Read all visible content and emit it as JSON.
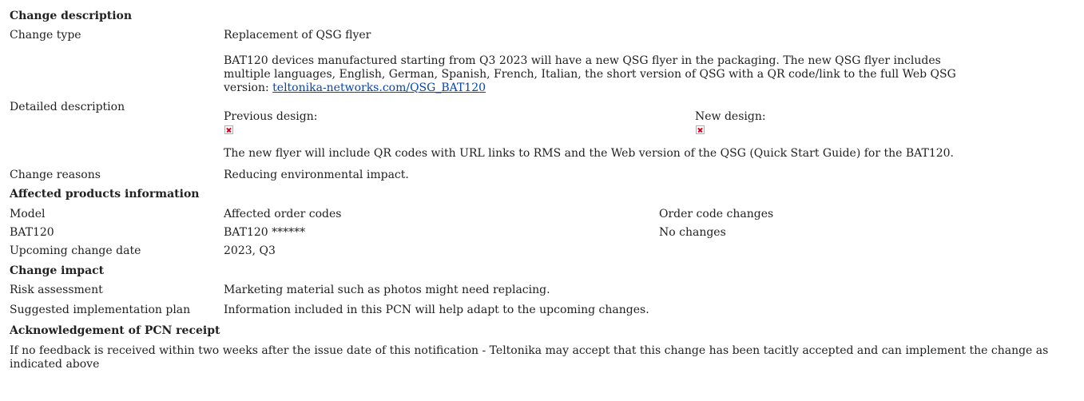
{
  "sections": {
    "change_description": "Change description",
    "affected_products": "Affected products information",
    "change_impact": "Change impact",
    "acknowledgement": "Acknowledgement of PCN receipt"
  },
  "change_type": {
    "label": "Change type",
    "value": "Replacement of QSG flyer"
  },
  "detailed": {
    "label": "Detailed description",
    "text_line1": "BAT120 devices manufactured starting from Q3 2023 will have a new QSG flyer in the packaging. The new QSG flyer includes",
    "text_line2": "multiple languages, English, German, Spanish, French, Italian, the short version of QSG with a QR code/link to the full Web QSG",
    "text_line3_prefix": "version: ",
    "link": "teltonika-networks.com/QSG_BAT120",
    "previous_design": "Previous design:",
    "new_design": "New design:",
    "note": "The new flyer will include QR codes with URL links to RMS and the Web version of the QSG (Quick Start Guide) for the BAT120."
  },
  "change_reasons": {
    "label": "Change reasons",
    "value": "Reducing environmental impact."
  },
  "products_table": {
    "headers": [
      "Model",
      "Affected order codes",
      "Order code changes"
    ],
    "rows": [
      [
        "BAT120",
        "BAT120 ******",
        "No changes"
      ]
    ]
  },
  "upcoming": {
    "label": "Upcoming change date",
    "value": "2023, Q3"
  },
  "risk": {
    "label": "Risk assessment",
    "value": "Marketing material such as photos might need replacing."
  },
  "plan": {
    "label": "Suggested implementation plan",
    "value": "Information included in this PCN will help adapt to the upcoming changes."
  },
  "ack": {
    "text": "If no feedback is received within two weeks after the issue date of this notification - Teltonika may accept that this change has been tacitly accepted and can implement the change as indicated above"
  }
}
